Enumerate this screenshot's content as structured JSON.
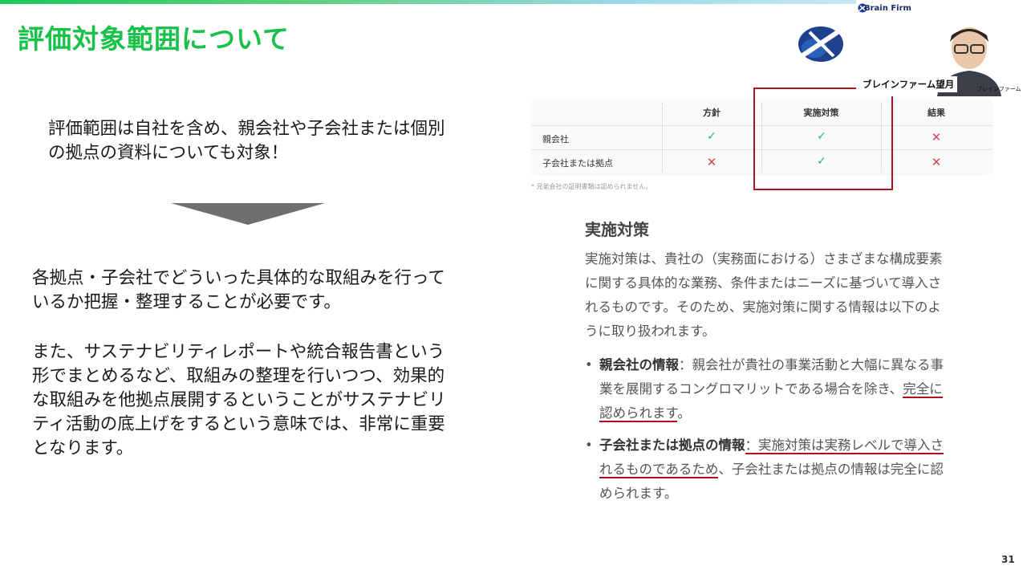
{
  "slide": {
    "title": "評価対象範囲について",
    "intro": "評価範囲は自社を含め、親会社や子会社または個別の拠点の資料についても対象！",
    "para1": "各拠点・子会社でどういった具体的な取組みを行っているか把握・整理することが必要です。",
    "para2": "また、サステナビリティレポートや統合報告書という形でまとめるなど、取組みの整理を行いつつ、効果的な取組みを他拠点展開するということがサステナビリティ活動の底上げをするという意味では、非常に重要となります。",
    "page_number": "31"
  },
  "table": {
    "headers": [
      "方針",
      "実施対策",
      "結果"
    ],
    "rows": [
      {
        "label": "親会社",
        "values": [
          "check",
          "check",
          "cross"
        ]
      },
      {
        "label": "子会社または拠点",
        "values": [
          "cross",
          "check",
          "cross"
        ]
      }
    ],
    "footnote": "* 兄弟会社の証明書類は認められません。"
  },
  "section": {
    "title": "実施対策",
    "body": "実施対策は、貴社の（実務面における）さまざまな構成要素に関する具体的な業務、条件またはニーズに基づいて導入されるものです。そのため、実施対策に関する情報は以下のように取り扱われます。",
    "bullet1_head": "親会社の情報",
    "bullet1_pre": "：親会社が貴社の事業活動と大幅に異なる事業を展開するコングロマリットである場合を除き、",
    "bullet1_ul": "完全に認められます",
    "bullet1_end": "。",
    "bullet2_head": "子会社または拠点の情報",
    "bullet2_ul": "：実施対策は実務レベルで導入されるものであるため",
    "bullet2_end": "、子会社または拠点の情報は完全に認められます。"
  },
  "webcam": {
    "logo_text": "Brain Firm",
    "name": "ブレインファーム望月",
    "brand": "ブレインファーム"
  },
  "colors": {
    "title_green": "#18c24a",
    "check_green": "#2eb85c",
    "cross_red": "#d9434b",
    "highlight_red": "#b10f1b"
  }
}
